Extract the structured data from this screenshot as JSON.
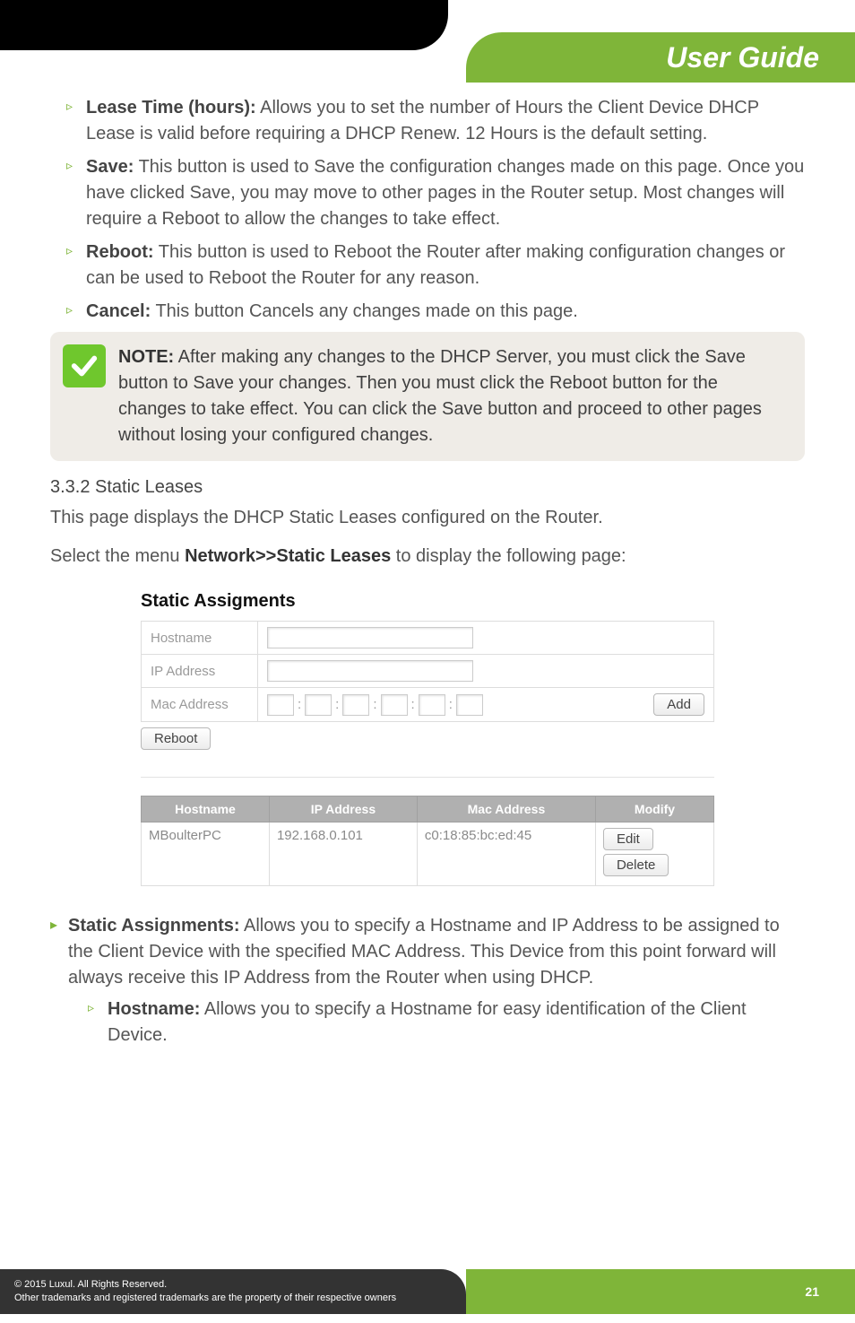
{
  "header": {
    "title": "User Guide"
  },
  "bullets": [
    {
      "label": "Lease Time (hours):",
      "text": " Allows you to set the number of Hours the Client Device DHCP Lease is valid before requiring a DHCP Renew. 12 Hours is the default setting."
    },
    {
      "label": "Save:",
      "text": " This button is used to Save the configuration changes made on this page. Once you have clicked Save, you may move to other pages in the Router setup. Most changes will require a Reboot to allow the changes to take effect."
    },
    {
      "label": "Reboot:",
      "text": " This button is used to Reboot the Router after making configuration changes or can be used to Reboot the Router for any reason."
    },
    {
      "label": "Cancel:",
      "text": " This button Cancels any changes made on this page."
    }
  ],
  "note": {
    "label": "NOTE:",
    "text": " After making any changes to the DHCP Server, you must click the Save button to Save your changes. Then you must click the Reboot button for the changes to take effect. You can click the Save button and proceed to other pages without losing your configured changes."
  },
  "section": {
    "heading": "3.3.2 Static Leases",
    "para1": "This page displays the DHCP Static Leases configured on the Router.",
    "para2_pre": "Select the menu ",
    "para2_menu": "Network>>Static Leases",
    "para2_post": " to display the following page:"
  },
  "panel": {
    "title": "Static Assigments",
    "labels": {
      "hostname": "Hostname",
      "ip": "IP Address",
      "mac": "Mac Address"
    },
    "add": "Add",
    "reboot": "Reboot"
  },
  "lease_table": {
    "headers": [
      "Hostname",
      "IP Address",
      "Mac Address",
      "Modify"
    ],
    "row": {
      "hostname": "MBoulterPC",
      "ip": "192.168.0.101",
      "mac": "c0:18:85:bc:ed:45",
      "edit": "Edit",
      "delete": "Delete"
    }
  },
  "definitions": {
    "static_label": "Static Assignments:",
    "static_text": " Allows you to specify a Hostname and IP Address to be assigned to the Client Device with the specified MAC Address. This Device from this point forward will always receive this IP Address from the Router when using DHCP.",
    "hostname_label": "Hostname:",
    "hostname_text": " Allows you to specify a Hostname for easy identification of the Client Device."
  },
  "footer": {
    "line1": "© 2015  Luxul. All Rights Reserved.",
    "line2": "Other trademarks and registered trademarks are the property of their respective owners",
    "page": "21"
  }
}
